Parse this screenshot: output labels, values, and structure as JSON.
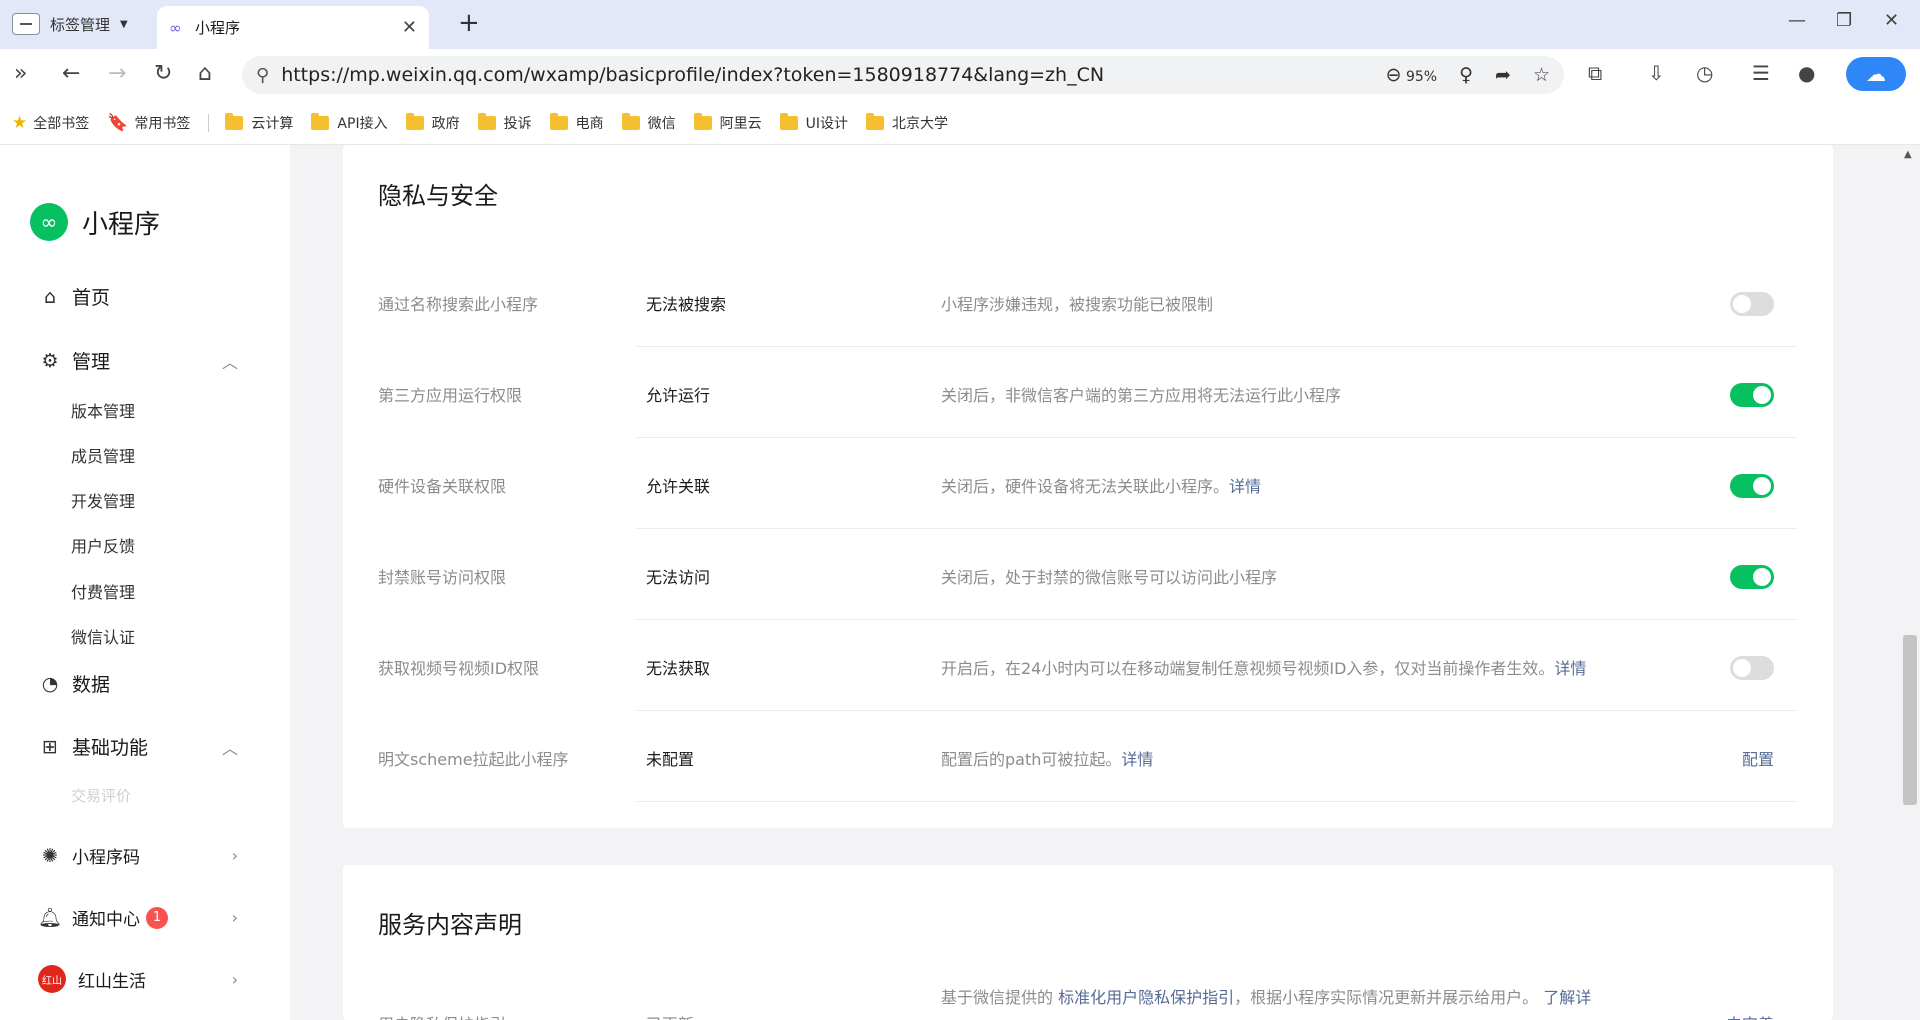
{
  "browser": {
    "tab_group_label": "标签管理",
    "active_tab": "小程序",
    "url": "https://mp.weixin.qq.com/wxamp/basicprofile/index?token=1580918774&lang=zh_CN",
    "zoom": "95%",
    "bookmarks": [
      "全部书签",
      "常用书签",
      "云计算",
      "API接入",
      "政府",
      "投诉",
      "电商",
      "微信",
      "阿里云",
      "UI设计",
      "北京大学"
    ]
  },
  "sidebar": {
    "app_name": "小程序",
    "home": "首页",
    "manage": "管理",
    "manage_items": [
      "版本管理",
      "成员管理",
      "开发管理",
      "用户反馈",
      "付费管理",
      "微信认证"
    ],
    "data": "数据",
    "basic": "基础功能",
    "basic_partial": "交易评价",
    "qrcode": "小程序码",
    "notice": "通知中心",
    "notice_badge": "1",
    "account": "红山生活",
    "account_avatar_text": "红山"
  },
  "privacy": {
    "title": "隐私与安全",
    "rows": [
      {
        "label": "通过名称搜索此小程序",
        "value": "无法被搜索",
        "desc": "小程序涉嫌违规，被搜索功能已被限制",
        "link": "",
        "toggle": false
      },
      {
        "label": "第三方应用运行权限",
        "value": "允许运行",
        "desc": "关闭后，非微信客户端的第三方应用将无法运行此小程序",
        "link": "",
        "toggle": true
      },
      {
        "label": "硬件设备关联权限",
        "value": "允许关联",
        "desc": "关闭后，硬件设备将无法关联此小程序。",
        "link": "详情",
        "toggle": true
      },
      {
        "label": "封禁账号访问权限",
        "value": "无法访问",
        "desc": "关闭后，处于封禁的微信账号可以访问此小程序",
        "link": "",
        "toggle": true
      },
      {
        "label": "获取视频号视频ID权限",
        "value": "无法获取",
        "desc": "开启后，在24小时内可以在移动端复制任意视频号视频ID入参，仅对当前操作者生效。",
        "link": "详情",
        "toggle": false
      },
      {
        "label": "明文scheme拉起此小程序",
        "value": "未配置",
        "desc": "配置后的path可被拉起。",
        "link": "详情",
        "action": "配置"
      }
    ]
  },
  "service": {
    "title": "服务内容声明",
    "row_label": "用户隐私保护指引",
    "row_value": "已更新",
    "row_desc_pre": "基于微信提供的",
    "row_desc_link": "标准化用户隐私保护指引",
    "row_desc_post": "，根据小程序实际情况更新并展示给用户。",
    "row_desc_link2": "了解详",
    "row_action": "去完善"
  }
}
